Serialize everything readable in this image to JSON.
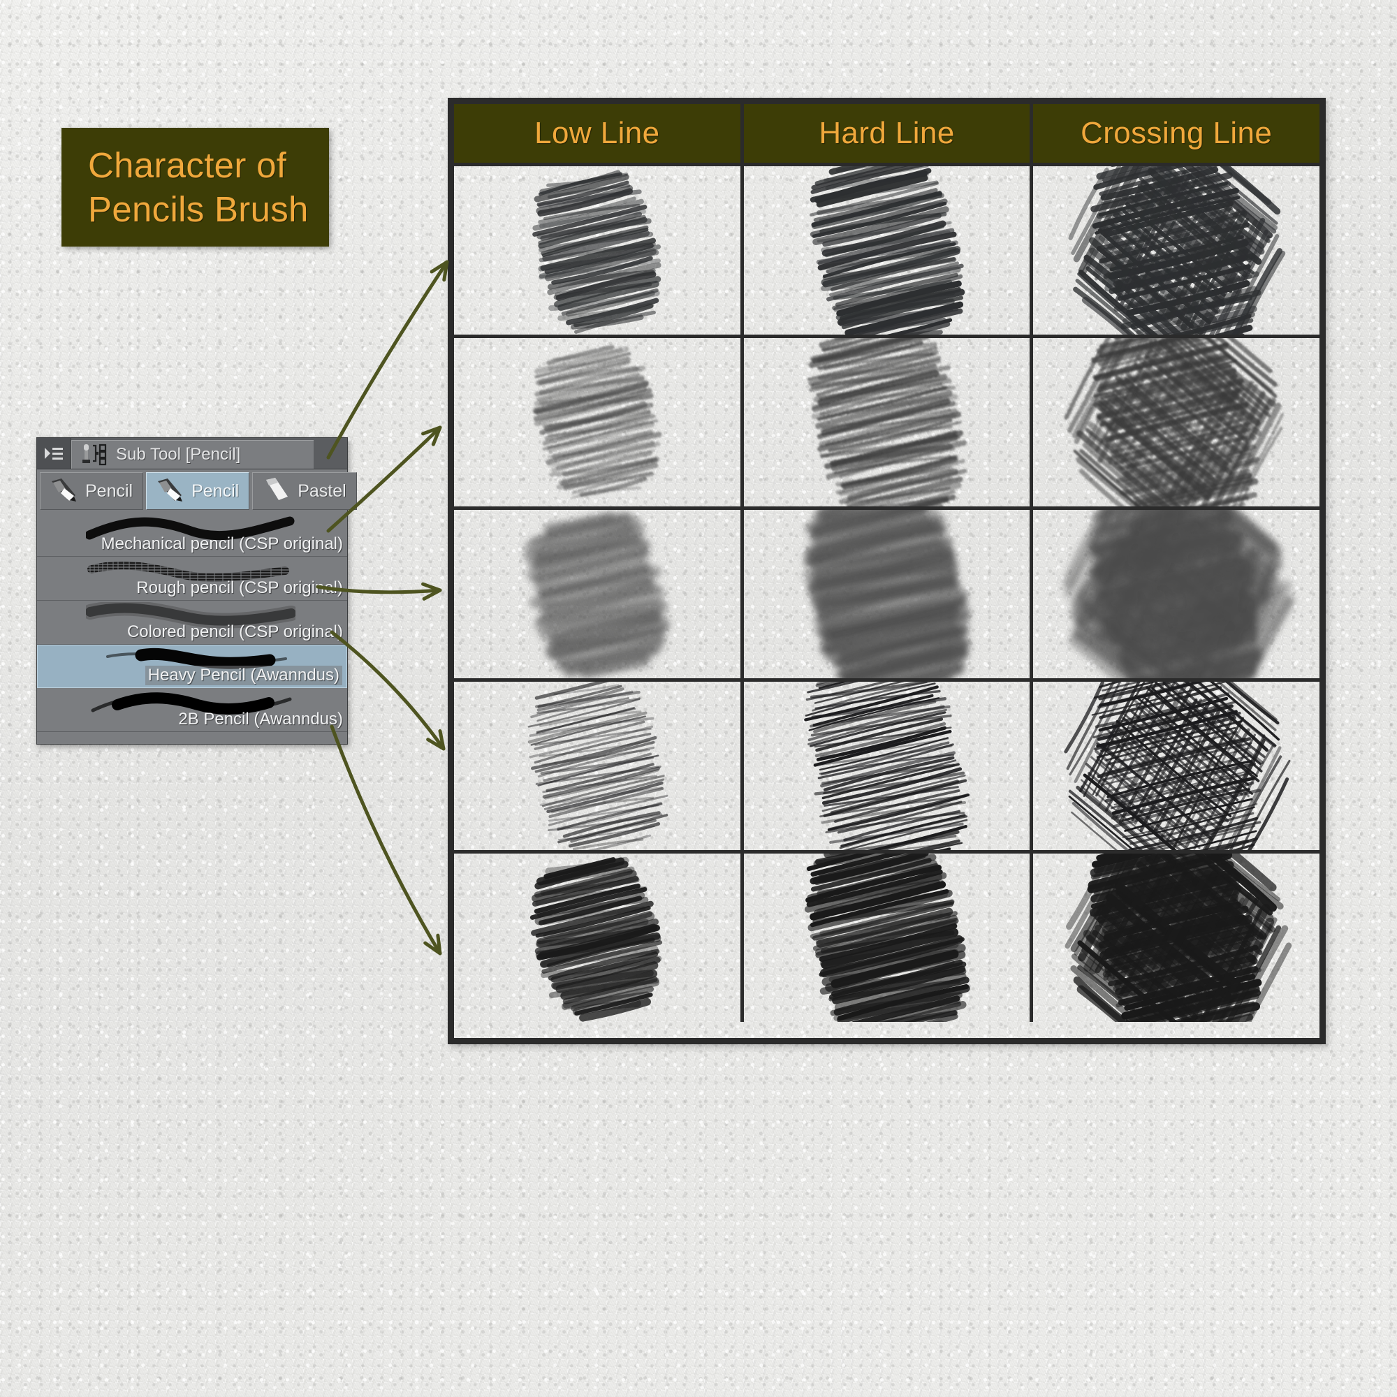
{
  "title": {
    "line1": "Character of",
    "line2": "Pencils Brush",
    "bg_color": "#3d3d06",
    "text_color": "#f0a83c"
  },
  "sub_tool_window": {
    "titlebar": {
      "menu_icon": "panel-menu-icon",
      "tab_icon": "sub-tool-icon",
      "label": "Sub Tool [Pencil]"
    },
    "tool_tabs": [
      {
        "label": "Pencil",
        "icon": "pencil-icon",
        "selected": false
      },
      {
        "label": "Pencil",
        "icon": "pencil-icon",
        "selected": true
      },
      {
        "label": "Pastel",
        "icon": "pastel-icon",
        "selected": false
      }
    ],
    "brushes": [
      {
        "name": "Mechanical pencil (CSP original)",
        "selected": false,
        "stroke_style": "smooth-dark"
      },
      {
        "name": "Rough pencil (CSP original)",
        "selected": false,
        "stroke_style": "grainy-sparse"
      },
      {
        "name": "Colored pencil (CSP original)",
        "selected": false,
        "stroke_style": "soft-wide"
      },
      {
        "name": "Heavy Pencil (Awanndus)",
        "selected": true,
        "stroke_style": "heavy-blob"
      },
      {
        "name": "2B Pencil (Awanndus)",
        "selected": false,
        "stroke_style": "bold-tapered"
      }
    ],
    "selected_row_color": "#97b1c2",
    "panel_color": "#7b7d80"
  },
  "chart_data": {
    "type": "table",
    "title": "Character of Pencils Brush",
    "columns": [
      "Low Line",
      "Hard Line",
      "Crossing Line"
    ],
    "rows": [
      {
        "brush": "Mechanical pencil (CSP original)",
        "cells": [
          {
            "column": "Low Line",
            "density": 0.45,
            "darkness": 0.7,
            "texture": "clean-line",
            "crosshatch": false
          },
          {
            "column": "Hard Line",
            "density": 0.7,
            "darkness": 0.88,
            "texture": "clean-line",
            "crosshatch": false
          },
          {
            "column": "Crossing Line",
            "density": 0.85,
            "darkness": 0.9,
            "texture": "clean-line",
            "crosshatch": true
          }
        ]
      },
      {
        "brush": "Rough pencil (CSP original)",
        "cells": [
          {
            "column": "Low Line",
            "density": 0.4,
            "darkness": 0.3,
            "texture": "grainy",
            "crosshatch": false
          },
          {
            "column": "Hard Line",
            "density": 0.75,
            "darkness": 0.58,
            "texture": "grainy",
            "crosshatch": false
          },
          {
            "column": "Crossing Line",
            "density": 0.85,
            "darkness": 0.62,
            "texture": "grainy",
            "crosshatch": true
          }
        ]
      },
      {
        "brush": "Colored pencil (CSP original)",
        "cells": [
          {
            "column": "Low Line",
            "density": 0.5,
            "darkness": 0.25,
            "texture": "soft-blur",
            "crosshatch": false
          },
          {
            "column": "Hard Line",
            "density": 0.8,
            "darkness": 0.55,
            "texture": "soft-blur",
            "crosshatch": false
          },
          {
            "column": "Crossing Line",
            "density": 0.9,
            "darkness": 0.48,
            "texture": "soft-blur",
            "crosshatch": true
          }
        ]
      },
      {
        "brush": "Heavy Pencil (Awanndus)",
        "cells": [
          {
            "column": "Low Line",
            "density": 0.55,
            "darkness": 0.42,
            "texture": "thin-hard",
            "crosshatch": false
          },
          {
            "column": "Hard Line",
            "density": 0.85,
            "darkness": 0.92,
            "texture": "thin-hard",
            "crosshatch": false
          },
          {
            "column": "Crossing Line",
            "density": 0.92,
            "darkness": 0.93,
            "texture": "thin-hard",
            "crosshatch": true
          }
        ]
      },
      {
        "brush": "2B Pencil (Awanndus)",
        "cells": [
          {
            "column": "Low Line",
            "density": 0.45,
            "darkness": 0.8,
            "texture": "bold-soft",
            "crosshatch": false
          },
          {
            "column": "Hard Line",
            "density": 0.8,
            "darkness": 0.9,
            "texture": "bold-soft",
            "crosshatch": false
          },
          {
            "column": "Crossing Line",
            "density": 0.9,
            "darkness": 0.9,
            "texture": "bold-soft",
            "crosshatch": true
          }
        ]
      }
    ],
    "header_bg": "#3d3d06",
    "header_text": "#f0a83c",
    "grid_color": "#2b2b2b",
    "grid": true,
    "legend": "none"
  },
  "annotations": {
    "arrow_color": "#4e5420",
    "arrows": [
      {
        "from_brush": "Mechanical pencil (CSP original)",
        "to_row": 1
      },
      {
        "from_brush": "Rough pencil (CSP original)",
        "to_row": 2
      },
      {
        "from_brush": "Colored pencil (CSP original)",
        "to_row": 3
      },
      {
        "from_brush": "Heavy Pencil (Awanndus)",
        "to_row": 4
      },
      {
        "from_brush": "2B Pencil (Awanndus)",
        "to_row": 5
      }
    ]
  }
}
